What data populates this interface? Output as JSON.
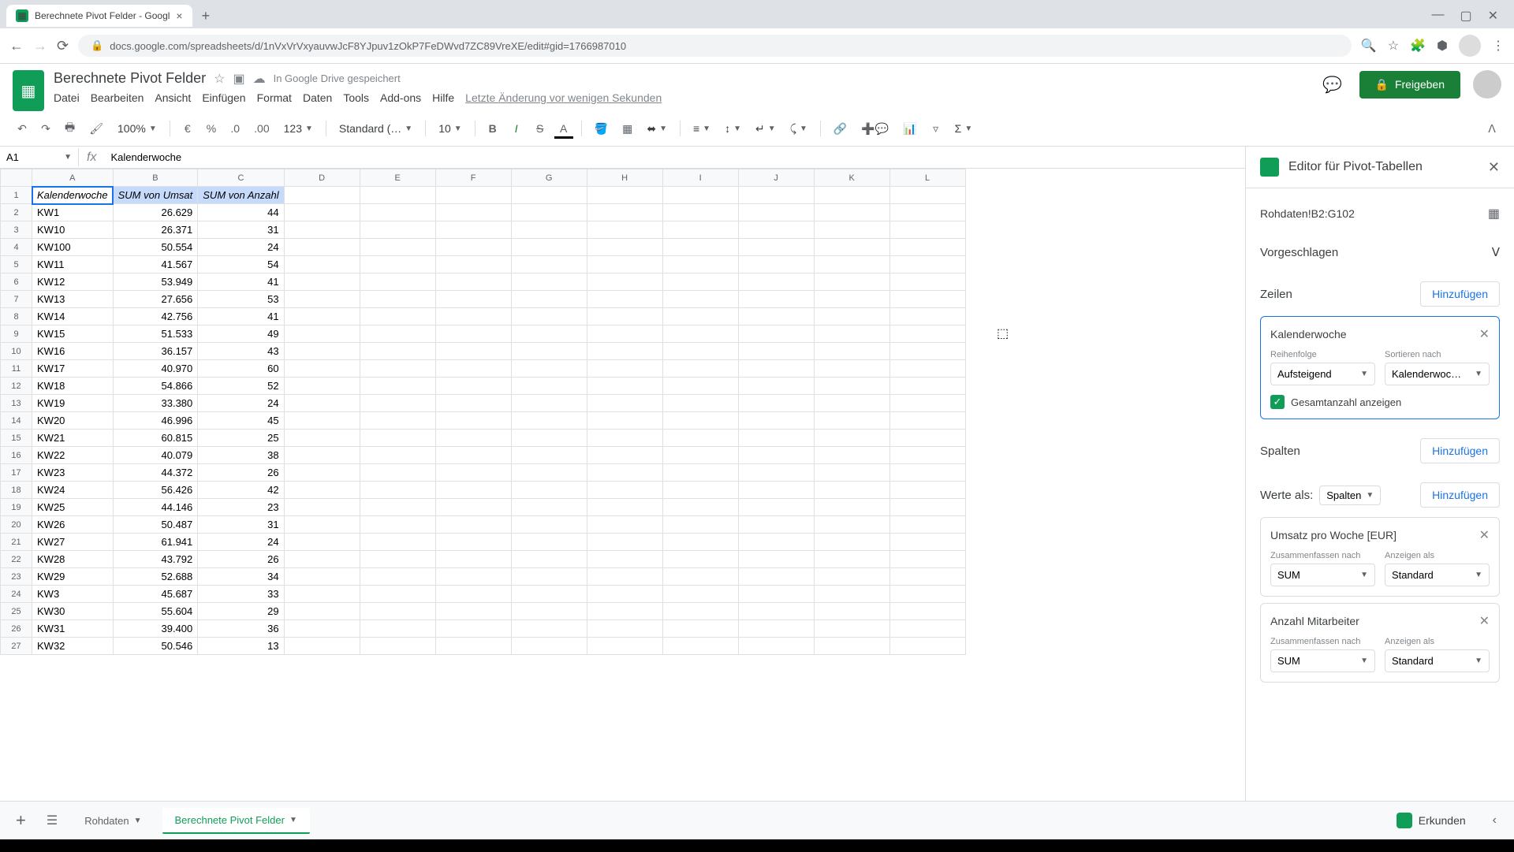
{
  "browser": {
    "tab_title": "Berechnete Pivot Felder - Googl",
    "url": "docs.google.com/spreadsheets/d/1nVxVrVxyauvwJcF8YJpuv1zOkP7FeDWvd7ZC89VreXE/edit#gid=1766987010"
  },
  "doc": {
    "title": "Berechnete Pivot Felder",
    "drive_status": "In Google Drive gespeichert",
    "last_edit": "Letzte Änderung vor wenigen Sekunden"
  },
  "menus": [
    "Datei",
    "Bearbeiten",
    "Ansicht",
    "Einfügen",
    "Format",
    "Daten",
    "Tools",
    "Add-ons",
    "Hilfe"
  ],
  "share_label": "Freigeben",
  "toolbar": {
    "zoom": "100%",
    "currency": "€",
    "percent": "%",
    "dec_less": ".0",
    "dec_more": ".00",
    "format_num": "123",
    "font": "Standard (…",
    "font_size": "10"
  },
  "name_box": "A1",
  "formula": "Kalenderwoche",
  "columns": [
    "A",
    "B",
    "C",
    "D",
    "E",
    "F",
    "G",
    "H",
    "I",
    "J",
    "K",
    "L"
  ],
  "headers": {
    "a": "Kalenderwoche",
    "b": "SUM von Umsat",
    "c": "SUM von Anzahl"
  },
  "rows": [
    {
      "n": 1,
      "a": "Kalenderwoche",
      "b": "SUM von Umsat",
      "c": "SUM von Anzahl",
      "hdr": true
    },
    {
      "n": 2,
      "a": "KW1",
      "b": "26.629",
      "c": "44"
    },
    {
      "n": 3,
      "a": "KW10",
      "b": "26.371",
      "c": "31"
    },
    {
      "n": 4,
      "a": "KW100",
      "b": "50.554",
      "c": "24"
    },
    {
      "n": 5,
      "a": "KW11",
      "b": "41.567",
      "c": "54"
    },
    {
      "n": 6,
      "a": "KW12",
      "b": "53.949",
      "c": "41"
    },
    {
      "n": 7,
      "a": "KW13",
      "b": "27.656",
      "c": "53"
    },
    {
      "n": 8,
      "a": "KW14",
      "b": "42.756",
      "c": "41"
    },
    {
      "n": 9,
      "a": "KW15",
      "b": "51.533",
      "c": "49"
    },
    {
      "n": 10,
      "a": "KW16",
      "b": "36.157",
      "c": "43"
    },
    {
      "n": 11,
      "a": "KW17",
      "b": "40.970",
      "c": "60"
    },
    {
      "n": 12,
      "a": "KW18",
      "b": "54.866",
      "c": "52"
    },
    {
      "n": 13,
      "a": "KW19",
      "b": "33.380",
      "c": "24"
    },
    {
      "n": 14,
      "a": "KW20",
      "b": "46.996",
      "c": "45"
    },
    {
      "n": 15,
      "a": "KW21",
      "b": "60.815",
      "c": "25"
    },
    {
      "n": 16,
      "a": "KW22",
      "b": "40.079",
      "c": "38"
    },
    {
      "n": 17,
      "a": "KW23",
      "b": "44.372",
      "c": "26"
    },
    {
      "n": 18,
      "a": "KW24",
      "b": "56.426",
      "c": "42"
    },
    {
      "n": 19,
      "a": "KW25",
      "b": "44.146",
      "c": "23"
    },
    {
      "n": 20,
      "a": "KW26",
      "b": "50.487",
      "c": "31"
    },
    {
      "n": 21,
      "a": "KW27",
      "b": "61.941",
      "c": "24"
    },
    {
      "n": 22,
      "a": "KW28",
      "b": "43.792",
      "c": "26"
    },
    {
      "n": 23,
      "a": "KW29",
      "b": "52.688",
      "c": "34"
    },
    {
      "n": 24,
      "a": "KW3",
      "b": "45.687",
      "c": "33"
    },
    {
      "n": 25,
      "a": "KW30",
      "b": "55.604",
      "c": "29"
    },
    {
      "n": 26,
      "a": "KW31",
      "b": "39.400",
      "c": "36"
    },
    {
      "n": 27,
      "a": "KW32",
      "b": "50.546",
      "c": "13"
    }
  ],
  "pivot": {
    "title": "Editor für Pivot-Tabellen",
    "range": "Rohdaten!B2:G102",
    "suggested": "Vorgeschlagen",
    "rows_label": "Zeilen",
    "add": "Hinzufügen",
    "row_card": {
      "title": "Kalenderwoche",
      "order_label": "Reihenfolge",
      "order_value": "Aufsteigend",
      "sort_label": "Sortieren nach",
      "sort_value": "Kalenderwoc…",
      "totals": "Gesamtanzahl anzeigen"
    },
    "cols_label": "Spalten",
    "values_label": "Werte als:",
    "values_select": "Spalten",
    "value_cards": [
      {
        "title": "Umsatz pro Woche [EUR]",
        "sum_label": "Zusammenfassen nach",
        "sum_val": "SUM",
        "show_label": "Anzeigen als",
        "show_val": "Standard"
      },
      {
        "title": "Anzahl Mitarbeiter",
        "sum_label": "Zusammenfassen nach",
        "sum_val": "SUM",
        "show_label": "Anzeigen als",
        "show_val": "Standard"
      }
    ]
  },
  "sheets": {
    "tab1": "Rohdaten",
    "tab2": "Berechnete Pivot Felder"
  },
  "explore": "Erkunden"
}
